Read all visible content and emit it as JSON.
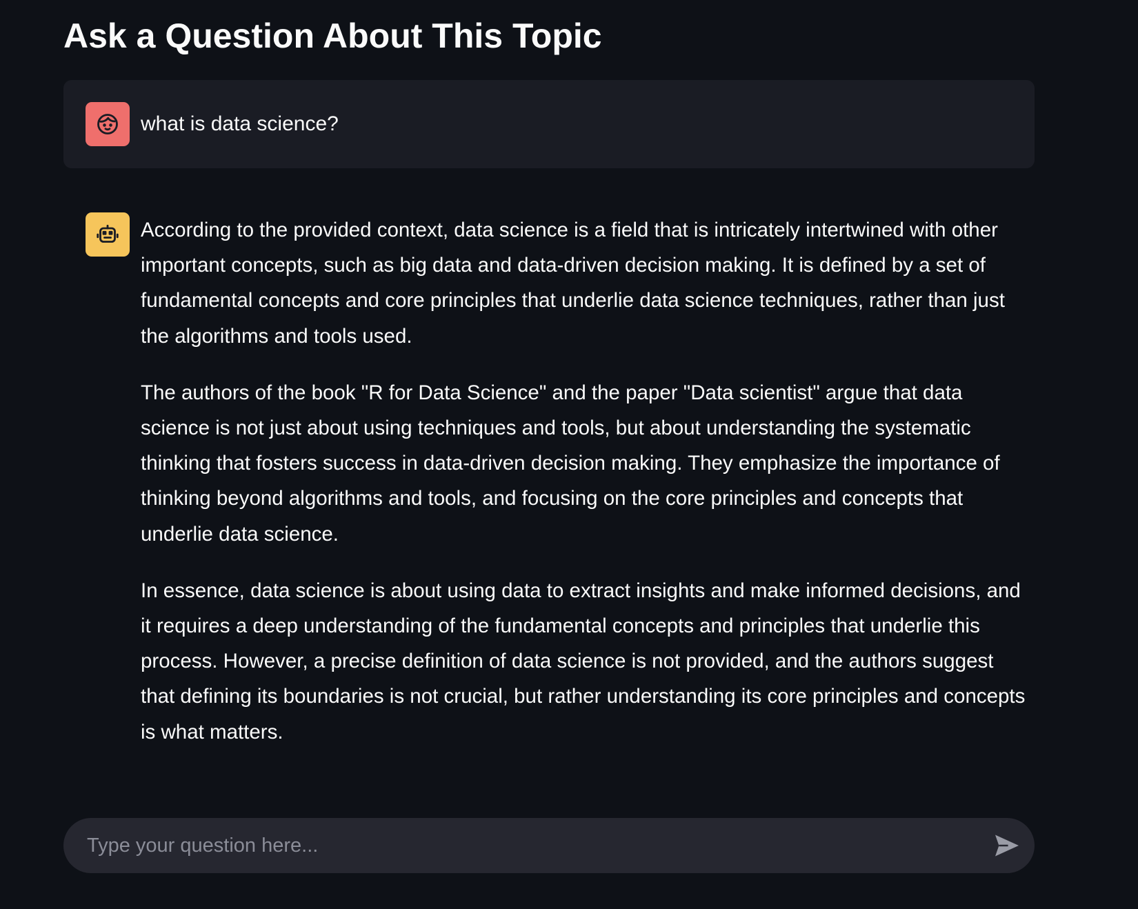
{
  "page": {
    "title": "Ask a Question About This Topic"
  },
  "messages": [
    {
      "role": "user",
      "avatar_icon": "user-face-icon",
      "avatar_color": "#ef6f6c",
      "text": "what is data science?"
    },
    {
      "role": "assistant",
      "avatar_icon": "robot-icon",
      "avatar_color": "#f6c55b",
      "paragraphs": [
        "According to the provided context, data science is a field that is intricately intertwined with other important concepts, such as big data and data-driven decision making. It is defined by a set of fundamental concepts and core principles that underlie data science techniques, rather than just the algorithms and tools used.",
        "The authors of the book \"R for Data Science\" and the paper \"Data scientist\" argue that data science is not just about using techniques and tools, but about understanding the systematic thinking that fosters success in data-driven decision making. They emphasize the importance of thinking beyond algorithms and tools, and focusing on the core principles and concepts that underlie data science.",
        "In essence, data science is about using data to extract insights and make informed decisions, and it requires a deep understanding of the fundamental concepts and principles that underlie this process. However, a precise definition of data science is not provided, and the authors suggest that defining its boundaries is not crucial, but rather understanding its core principles and concepts is what matters."
      ]
    }
  ],
  "chat_input": {
    "value": "",
    "placeholder": "Type your question here...",
    "send_icon": "send-icon"
  },
  "colors": {
    "background": "#0e1117",
    "user_message_bg": "#1a1c24",
    "input_bg": "#262730",
    "text": "#fafafa",
    "placeholder": "#8b8d98"
  }
}
